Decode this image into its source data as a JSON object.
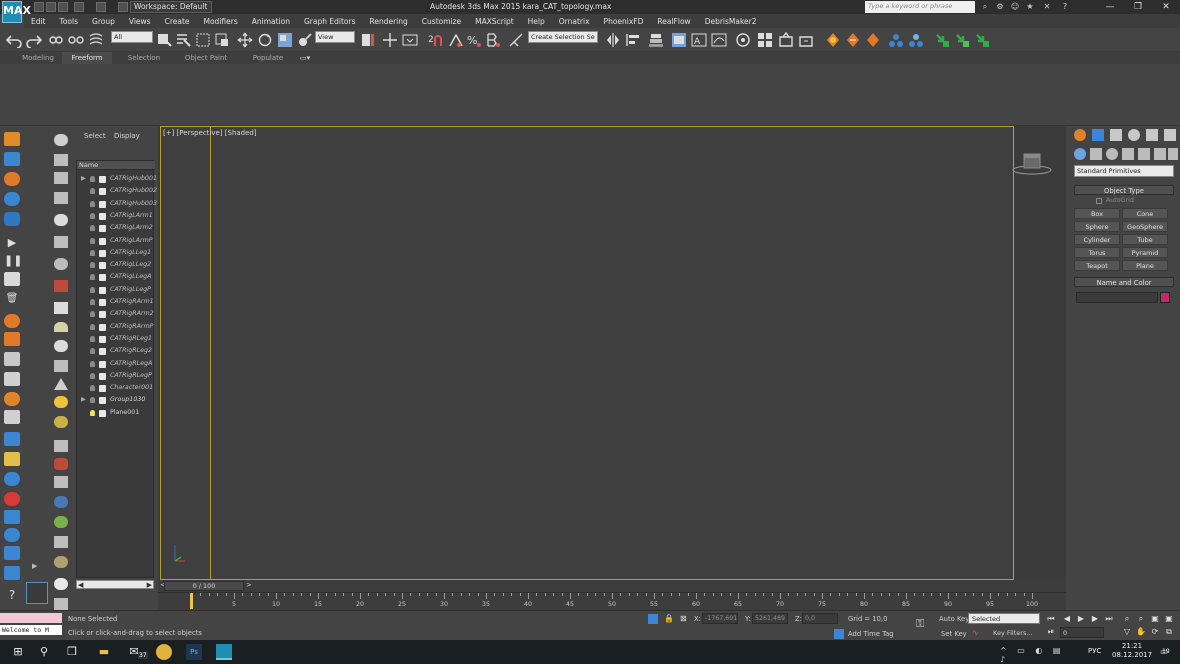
{
  "titlebar": {
    "logo": "MAX",
    "workspace": "Workspace: Default",
    "window_title": "Autodesk 3ds Max  2015    kara_CAT_topology.max",
    "search_placeholder": "Type a keyword or phrase",
    "window_controls": [
      "—",
      "❐",
      "✕"
    ]
  },
  "menu": [
    "Edit",
    "Tools",
    "Group",
    "Views",
    "Create",
    "Modifiers",
    "Animation",
    "Graph Editors",
    "Rendering",
    "Customize",
    "MAXScript",
    "Help",
    "Ornatrix",
    "PhoenixFD",
    "RealFlow",
    "DebrisMaker2"
  ],
  "toolbar": {
    "selection_filter": "All",
    "ref_coord": "View",
    "named_selection": "Create Selection Se"
  },
  "ribbon_tabs": [
    "Modeling",
    "Freeform",
    "Selection",
    "Object Paint",
    "Populate"
  ],
  "ribbon_active": "Freeform",
  "explorer": {
    "tab_select": "Select",
    "tab_display": "Display",
    "column_name": "Name",
    "rows": [
      {
        "label": "CATRigHub001",
        "expand": "▶"
      },
      {
        "label": "CATRigHub002",
        "expand": ""
      },
      {
        "label": "CATRigHub003",
        "expand": ""
      },
      {
        "label": "CATRigLArm1",
        "expand": ""
      },
      {
        "label": "CATRigLArm2",
        "expand": ""
      },
      {
        "label": "CATRigLArmP",
        "expand": ""
      },
      {
        "label": "CATRigLLeg1",
        "expand": ""
      },
      {
        "label": "CATRigLLeg2",
        "expand": ""
      },
      {
        "label": "CATRigLLegA",
        "expand": ""
      },
      {
        "label": "CATRigLLegP",
        "expand": ""
      },
      {
        "label": "CATRigRArm1",
        "expand": ""
      },
      {
        "label": "CATRigRArm2",
        "expand": ""
      },
      {
        "label": "CATRigRArmP",
        "expand": ""
      },
      {
        "label": "CATRigRLeg1",
        "expand": ""
      },
      {
        "label": "CATRigRLeg2",
        "expand": ""
      },
      {
        "label": "CATRigRLegA",
        "expand": ""
      },
      {
        "label": "CATRigRLegP",
        "expand": ""
      },
      {
        "label": "Character001",
        "expand": ""
      },
      {
        "label": "Group1030",
        "expand": "▶"
      },
      {
        "label": "Plane001",
        "expand": ""
      }
    ]
  },
  "viewport": {
    "label": "[+] [Perspective] [Shaded]"
  },
  "timeslider": {
    "position": "0 / 100",
    "prev": "<",
    "next": ">"
  },
  "trackbar": {
    "ticks": [
      "0",
      "5",
      "10",
      "15",
      "20",
      "25",
      "30",
      "35",
      "40",
      "45",
      "50",
      "55",
      "60",
      "65",
      "70",
      "75",
      "80",
      "85",
      "90",
      "95",
      "100"
    ]
  },
  "cmdpanel": {
    "primitive_type": "Standard Primitives",
    "object_type_title": "Object Type",
    "autogrid": "AutoGrid",
    "buttons": [
      "Box",
      "Cone",
      "Sphere",
      "GeoSphere",
      "Cylinder",
      "Tube",
      "Torus",
      "Pyramid",
      "Teapot",
      "Plane"
    ],
    "name_color_title": "Name and Color",
    "swatch_color": "#c2286e"
  },
  "status": {
    "maxscript_listener": "Welcome to M",
    "selection": "None Selected",
    "prompt": "Click or click-and-drag to select objects",
    "x_label": "X:",
    "x_value": "-1767,691",
    "y_label": "Y:",
    "y_value": "5261,489",
    "z_label": "Z:",
    "z_value": "0,0",
    "grid": "Grid = 10,0",
    "add_time_tag": "Add Time Tag",
    "auto_key": "Auto Key",
    "set_key": "Set Key",
    "key_mode": "Selected",
    "key_filters": "Key Filters...",
    "frame": "0"
  },
  "taskbar": {
    "time": "21:21",
    "date": "08.12.2017",
    "lang": "РУС",
    "mail_count": "37",
    "notif_count": "19"
  }
}
